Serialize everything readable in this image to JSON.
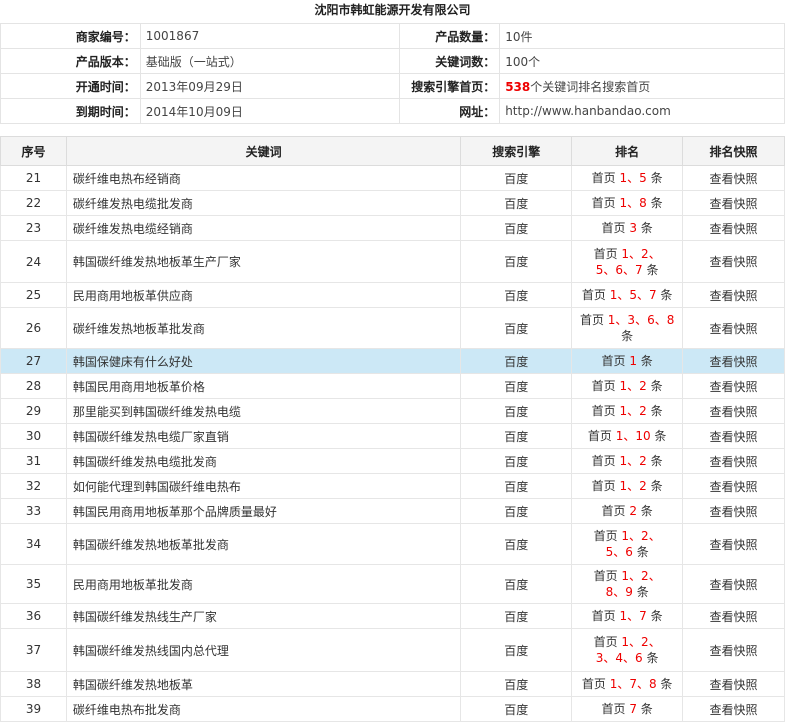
{
  "company_title": "沈阳市韩虹能源开发有限公司",
  "info": {
    "merchant_id_label": "商家编号：",
    "merchant_id": "1001867",
    "product_qty_label": "产品数量：",
    "product_qty": "10件",
    "product_version_label": "产品版本：",
    "product_version": "基础版（一站式）",
    "keyword_count_label": "关键词数：",
    "keyword_count": "100个",
    "open_time_label": "开通时间：",
    "open_time": "2013年09月29日",
    "search_home_label": "搜索引擎首页：",
    "search_home_count": "538",
    "search_home_text": "个关键词排名搜索首页",
    "expire_time_label": "到期时间：",
    "expire_time": "2014年10月09日",
    "url_label": "网址：",
    "url": "http://www.hanbandao.com"
  },
  "table": {
    "headers": {
      "no": "序号",
      "keyword": "关键词",
      "engine": "搜索引擎",
      "rank": "排名",
      "snapshot": "排名快照"
    },
    "rows": [
      {
        "no": "21",
        "keyword": "碳纤维电热布经销商",
        "engine": "百度",
        "rank_prefix": "首页",
        "rank_nums": "1、5",
        "rank_suffix": "条",
        "snapshot": "查看快照"
      },
      {
        "no": "22",
        "keyword": "碳纤维发热电缆批发商",
        "engine": "百度",
        "rank_prefix": "首页",
        "rank_nums": "1、8",
        "rank_suffix": "条",
        "snapshot": "查看快照"
      },
      {
        "no": "23",
        "keyword": "碳纤维发热电缆经销商",
        "engine": "百度",
        "rank_prefix": "首页",
        "rank_nums": "3",
        "rank_suffix": "条",
        "snapshot": "查看快照"
      },
      {
        "no": "24",
        "keyword": "韩国碳纤维发热地板革生产厂家",
        "engine": "百度",
        "rank_prefix": "首页",
        "rank_nums": "1、2、5、6、7",
        "rank_suffix": "条",
        "snapshot": "查看快照"
      },
      {
        "no": "25",
        "keyword": "民用商用地板革供应商",
        "engine": "百度",
        "rank_prefix": "首页",
        "rank_nums": "1、5、7",
        "rank_suffix": "条",
        "snapshot": "查看快照"
      },
      {
        "no": "26",
        "keyword": "碳纤维发热地板革批发商",
        "engine": "百度",
        "rank_prefix": "首页",
        "rank_nums": "1、3、6、8",
        "rank_suffix": "条",
        "snapshot": "查看快照"
      },
      {
        "no": "27",
        "keyword": "韩国保健床有什么好处",
        "engine": "百度",
        "rank_prefix": "首页",
        "rank_nums": "1",
        "rank_suffix": "条",
        "snapshot": "查看快照"
      },
      {
        "no": "28",
        "keyword": "韩国民用商用地板革价格",
        "engine": "百度",
        "rank_prefix": "首页",
        "rank_nums": "1、2",
        "rank_suffix": "条",
        "snapshot": "查看快照"
      },
      {
        "no": "29",
        "keyword": "那里能买到韩国碳纤维发热电缆",
        "engine": "百度",
        "rank_prefix": "首页",
        "rank_nums": "1、2",
        "rank_suffix": "条",
        "snapshot": "查看快照"
      },
      {
        "no": "30",
        "keyword": "韩国碳纤维发热电缆厂家直销",
        "engine": "百度",
        "rank_prefix": "首页",
        "rank_nums": "1、10",
        "rank_suffix": "条",
        "snapshot": "查看快照"
      },
      {
        "no": "31",
        "keyword": "韩国碳纤维发热电缆批发商",
        "engine": "百度",
        "rank_prefix": "首页",
        "rank_nums": "1、2",
        "rank_suffix": "条",
        "snapshot": "查看快照"
      },
      {
        "no": "32",
        "keyword": "如何能代理到韩国碳纤维电热布",
        "engine": "百度",
        "rank_prefix": "首页",
        "rank_nums": "1、2",
        "rank_suffix": "条",
        "snapshot": "查看快照"
      },
      {
        "no": "33",
        "keyword": "韩国民用商用地板革那个品牌质量最好",
        "engine": "百度",
        "rank_prefix": "首页",
        "rank_nums": "2",
        "rank_suffix": "条",
        "snapshot": "查看快照"
      },
      {
        "no": "34",
        "keyword": "韩国碳纤维发热地板革批发商",
        "engine": "百度",
        "rank_prefix": "首页",
        "rank_nums": "1、2、5、6",
        "rank_suffix": "条",
        "snapshot": "查看快照"
      },
      {
        "no": "35",
        "keyword": "民用商用地板革批发商",
        "engine": "百度",
        "rank_prefix": "首页",
        "rank_nums": "1、2、8、9",
        "rank_suffix": "条",
        "snapshot": "查看快照"
      },
      {
        "no": "36",
        "keyword": "韩国碳纤维发热线生产厂家",
        "engine": "百度",
        "rank_prefix": "首页",
        "rank_nums": "1、7",
        "rank_suffix": "条",
        "snapshot": "查看快照"
      },
      {
        "no": "37",
        "keyword": "韩国碳纤维发热线国内总代理",
        "engine": "百度",
        "rank_prefix": "首页",
        "rank_nums": "1、2、3、4、6",
        "rank_suffix": "条",
        "snapshot": "查看快照"
      },
      {
        "no": "38",
        "keyword": "韩国碳纤维发热地板革",
        "engine": "百度",
        "rank_prefix": "首页",
        "rank_nums": "1、7、8",
        "rank_suffix": "条",
        "snapshot": "查看快照"
      },
      {
        "no": "39",
        "keyword": "碳纤维电热布批发商",
        "engine": "百度",
        "rank_prefix": "首页",
        "rank_nums": "7",
        "rank_suffix": "条",
        "snapshot": "查看快照"
      }
    ]
  }
}
